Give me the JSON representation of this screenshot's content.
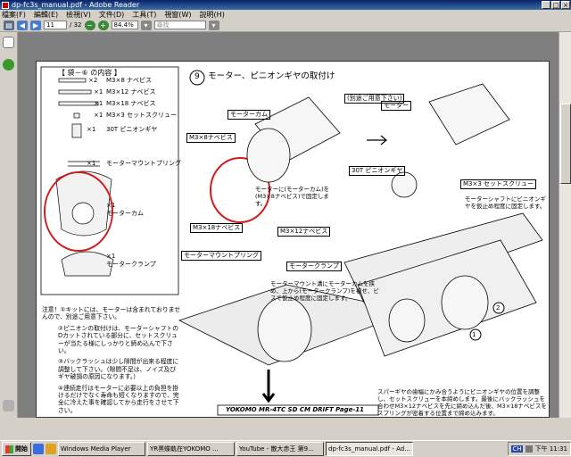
{
  "window": {
    "title": "dp-fc3s_manual.pdf - Adobe Reader",
    "controls": [
      "_",
      "□",
      "×"
    ]
  },
  "menu": [
    "檔案(F)",
    "編輯(E)",
    "檢視(V)",
    "文件(D)",
    "工具(T)",
    "視窗(W)",
    "說明(H)"
  ],
  "toolbar": {
    "page": "11",
    "page_total": "/ 32",
    "zoom": "84.4%",
    "search_placeholder": "尋找"
  },
  "doc": {
    "bag_title": "【 袋－⑥ の内容 】",
    "parts": [
      {
        "qty": "×2",
        "name": "M3×8 ナベビス"
      },
      {
        "qty": "×1",
        "name": "M3×12 ナベビス"
      },
      {
        "qty": "×1",
        "name": "M3×18 ナベビス"
      },
      {
        "qty": "×1",
        "name": "M3×3 セットスクリュー"
      },
      {
        "qty": "×1",
        "name": "30T ピニオンギヤ"
      },
      {
        "qty": "×1",
        "name": "モーターマウントプリング"
      },
      {
        "qty": "×1",
        "name": "モーターカム"
      },
      {
        "qty": "×1",
        "name": "モータークランプ"
      }
    ],
    "step_num": "9",
    "step_title": "モーター、ピニオンギヤの取付け",
    "label_motor": "モーター",
    "label_motor_ndi": "(別途ご用意下さい)",
    "label_pinion": "30T ピニオンギヤ",
    "label_setscrew": "M3×3 セットスクリュー",
    "label_m3x8": "M3×8ナベビス",
    "label_m3x12": "M3×12ナベビス",
    "label_m3x18": "M3×18ナベビス",
    "label_clamp": "モータークランプ",
    "label_spring": "モーターマウントプリング",
    "label_cam": "モーターカム",
    "note_mount": "モーターに(モーターカム)を(M3×8ナベビス)で固定します。",
    "note_setscrew": "モーターシャフトにビニオンギヤを仮止め程度に固定します。",
    "note_clamp": "モーターマウント溝にモーターカムを挟め、上から(モータークランプ)を被せ、ビスで仮止め程度に固定します。",
    "caution": [
      "注意！①キットには、モーターは含まれておりませんので、別途ご用意下さい。",
      "②ピニオンの取付けは、モーターシャフトのDカットされている部分に、セットスクリューが当たる様にしっかりと締め込んで下さい。",
      "③バックラッシュは少し隙間が出来る程度に調整して下さい。（隙間不足は、ノイズ及びギヤ破損の原因になります。）",
      "④連続走行はモーターに必要以上の負担を掛けるだけでなく寿命も短くなりますので、完全に冷えた事を確認してから走行をさせて下さい。"
    ],
    "adjust_note": "スパーギヤの歯幅にかみ合うようにビニオンギヤの位置を調整し、セットスクリューを本締めします。最後にバックラッシュを合わせM3×12ナベビスを先に締め込んだ後、M3×18ナベビスをスプリングが密着する位置まで締め込みます。",
    "footer": "YOKOMO MR-4TC SD CM DRIFT   Page-11",
    "circled": [
      "1",
      "2"
    ]
  },
  "taskbar": {
    "start": "開始",
    "tasks": [
      "Windows Media Player",
      "YR黒蝶軌在YOKOMO ...",
      "YouTube - 散大赤王 第9...",
      "dp-fc3s_manual.pdf - Ad..."
    ],
    "tray_lang": "CH",
    "clock": "下午 11:31"
  },
  "colors": {
    "titlebar": "#0a246a",
    "highlight": "#d01c1c",
    "chrome": "#d4d0c8"
  }
}
